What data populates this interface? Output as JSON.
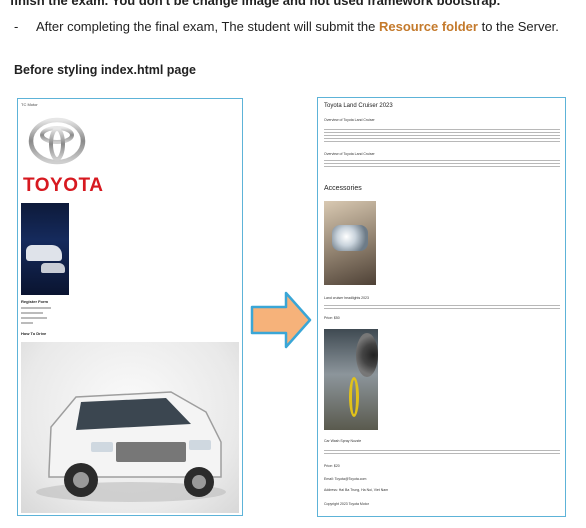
{
  "doc": {
    "cut_line": "finish the exam. You don't be change image and not used framework bootstrap.",
    "bullet_dash": "-",
    "bullet_before": "After completing the final exam, The student will submit the ",
    "bullet_highlight": "Resource folder",
    "bullet_after": " to the Server.",
    "section_title": "Before styling index.html page"
  },
  "left_page": {
    "title": "TC Motor",
    "brand": "TOYOTA",
    "register": "Register Form",
    "fellow": "How To Drive"
  },
  "right_page": {
    "heading": "Toyota Land Cruiser 2023",
    "sub1": "Overview of Toyota Land Cruiser",
    "sub2": "Overview of Toyota Land Cruiser",
    "accessories": "Accessories",
    "item1_title": "Land cruiser headlights 2023",
    "item1_price": "Price: $50",
    "item2_title": "Car Wash Spray Nozzle",
    "item2_price": "Price: $20",
    "footer1": "Email: Toyota@Toyota.com",
    "footer2": "Address: Hai Ba Trung, Ha Noi, Viet Nam",
    "footer3": "Copyright 2023 Toyota Motor"
  },
  "colors": {
    "panel_border": "#5db3d8",
    "highlight": "#c47a2c",
    "brand_red": "#d71920",
    "arrow_fill": "#f6b27a",
    "arrow_stroke": "#3aa6d6"
  }
}
